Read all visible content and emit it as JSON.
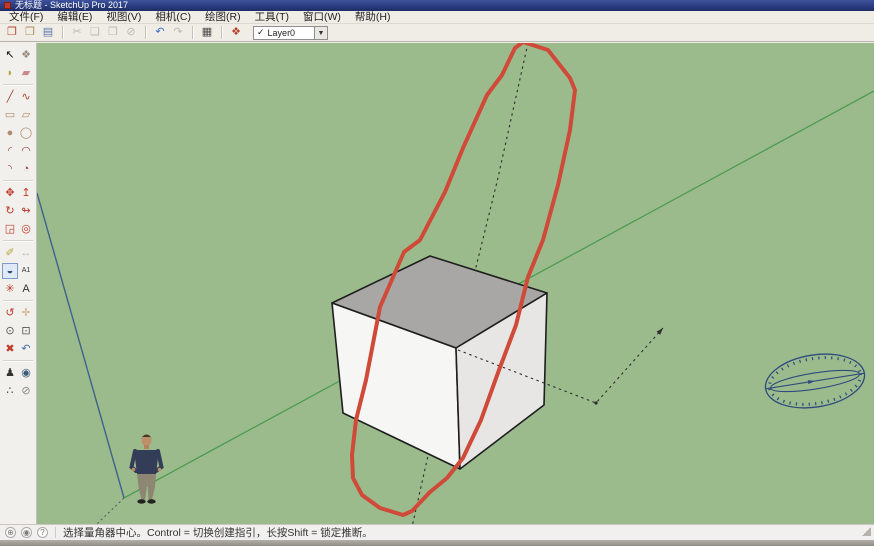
{
  "window": {
    "title": "无标题 - SketchUp Pro 2017"
  },
  "colors": {
    "titlebar": "#1d2c66",
    "viewport_bg": "#9cbb8c",
    "axis_green": "#4d9b51",
    "axis_blue": "#41618e",
    "cube_top": "#a8a7a5",
    "cube_left": "#f6f6f4",
    "cube_right": "#e7e6e4",
    "cube_edge": "#1e1e1e",
    "sketch_red": "#cf4a38",
    "protractor_blue": "#2e4b7e",
    "guide_dark": "#2f2f2f"
  },
  "menu": {
    "items": [
      {
        "name": "file",
        "label": "文件(F)"
      },
      {
        "name": "edit",
        "label": "编辑(E)"
      },
      {
        "name": "view",
        "label": "视图(V)"
      },
      {
        "name": "camera",
        "label": "相机(C)"
      },
      {
        "name": "draw",
        "label": "绘图(R)"
      },
      {
        "name": "tools",
        "label": "工具(T)"
      },
      {
        "name": "window",
        "label": "窗口(W)"
      },
      {
        "name": "help",
        "label": "帮助(H)"
      }
    ]
  },
  "toolbar": {
    "buttons": [
      {
        "name": "new",
        "glyph": "❐",
        "color": "#b8452f",
        "disabled": false
      },
      {
        "name": "open",
        "glyph": "❒",
        "color": "#b08d5e",
        "disabled": false
      },
      {
        "name": "save",
        "glyph": "▤",
        "color": "#5a77a8",
        "disabled": false
      },
      {
        "name": "separator"
      },
      {
        "name": "cut",
        "glyph": "✂",
        "color": "#777777",
        "disabled": true
      },
      {
        "name": "copy",
        "glyph": "❑",
        "color": "#777777",
        "disabled": true
      },
      {
        "name": "paste",
        "glyph": "❒",
        "color": "#777777",
        "disabled": true
      },
      {
        "name": "delete",
        "glyph": "⊘",
        "color": "#777777",
        "disabled": true
      },
      {
        "name": "separator"
      },
      {
        "name": "undo",
        "glyph": "↶",
        "color": "#3b6cc4",
        "disabled": false
      },
      {
        "name": "redo",
        "glyph": "↷",
        "color": "#777777",
        "disabled": true
      },
      {
        "name": "separator"
      },
      {
        "name": "print",
        "glyph": "▦",
        "color": "#4a4a4a",
        "disabled": false
      },
      {
        "name": "separator"
      },
      {
        "name": "model-info",
        "glyph": "❖",
        "color": "#b8452f",
        "disabled": false
      }
    ],
    "layer": {
      "check": "✓",
      "value": "Layer0",
      "arrow": "▼"
    }
  },
  "palette": {
    "groups": [
      [
        {
          "name": "select",
          "glyph": "↖",
          "color": "#111111"
        },
        {
          "name": "make-component",
          "glyph": "❖",
          "color": "#9a8b7a"
        },
        {
          "name": "paint-bucket",
          "glyph": "◗",
          "color": "#b5a642"
        },
        {
          "name": "eraser",
          "glyph": "▰",
          "color": "#c98b8b"
        }
      ],
      [
        {
          "name": "line",
          "glyph": "╱",
          "color": "#a5453a"
        },
        {
          "name": "freehand",
          "glyph": "∿",
          "color": "#a5453a"
        },
        {
          "name": "rectangle",
          "glyph": "▭",
          "color": "#b08d6e"
        },
        {
          "name": "rotated-rectangle",
          "glyph": "▱",
          "color": "#b08d6e"
        },
        {
          "name": "circle",
          "glyph": "●",
          "color": "#b08d6e"
        },
        {
          "name": "polygon",
          "glyph": "◯",
          "color": "#b08d6e"
        },
        {
          "name": "two-point-arc",
          "glyph": "◜",
          "color": "#a5453a"
        },
        {
          "name": "arc",
          "glyph": "◠",
          "color": "#a5453a"
        },
        {
          "name": "three-point-arc",
          "glyph": "◝",
          "color": "#a5453a"
        },
        {
          "name": "pie",
          "glyph": "◔",
          "color": "#a5453a"
        }
      ],
      [
        {
          "name": "move",
          "glyph": "✥",
          "color": "#c0392b"
        },
        {
          "name": "push-pull",
          "glyph": "↥",
          "color": "#c0392b"
        },
        {
          "name": "rotate",
          "glyph": "↻",
          "color": "#c0392b"
        },
        {
          "name": "follow-me",
          "glyph": "↬",
          "color": "#c0392b"
        },
        {
          "name": "scale",
          "glyph": "◲",
          "color": "#c0392b"
        },
        {
          "name": "offset",
          "glyph": "◎",
          "color": "#c0392b"
        }
      ],
      [
        {
          "name": "tape-measure",
          "glyph": "✐",
          "color": "#b5a642"
        },
        {
          "name": "dimension",
          "glyph": "↔",
          "color": "#777777",
          "disabled": true
        },
        {
          "name": "protractor",
          "glyph": "◒",
          "color": "#2e4b7e",
          "selected": true
        },
        {
          "name": "text",
          "glyph": "A1",
          "color": "#333333"
        },
        {
          "name": "axes",
          "glyph": "✳",
          "color": "#c0392b"
        },
        {
          "name": "3d-text",
          "glyph": "A",
          "color": "#333333"
        }
      ],
      [
        {
          "name": "orbit",
          "glyph": "↺",
          "color": "#c0392b"
        },
        {
          "name": "pan",
          "glyph": "✛",
          "color": "#c9a876"
        },
        {
          "name": "zoom",
          "glyph": "⊙",
          "color": "#555555"
        },
        {
          "name": "zoom-window",
          "glyph": "⊡",
          "color": "#555555"
        },
        {
          "name": "zoom-extents",
          "glyph": "✖",
          "color": "#c0392b"
        },
        {
          "name": "previous-view",
          "glyph": "↶",
          "color": "#4a6fa5"
        }
      ],
      [
        {
          "name": "position-camera",
          "glyph": "♟",
          "color": "#333333"
        },
        {
          "name": "look-around",
          "glyph": "◉",
          "color": "#3a5a7a"
        },
        {
          "name": "walk",
          "glyph": "∴",
          "color": "#333333"
        },
        {
          "name": "section-plane",
          "glyph": "⊘",
          "color": "#888888"
        }
      ]
    ]
  },
  "statusbar": {
    "icons": [
      {
        "name": "geolocation",
        "glyph": "⊕"
      },
      {
        "name": "credits",
        "glyph": "◉"
      },
      {
        "name": "help",
        "glyph": "?"
      }
    ],
    "hint": "选择量角器中心。Control = 切换创建指引，长按Shift = 锁定推断。"
  }
}
